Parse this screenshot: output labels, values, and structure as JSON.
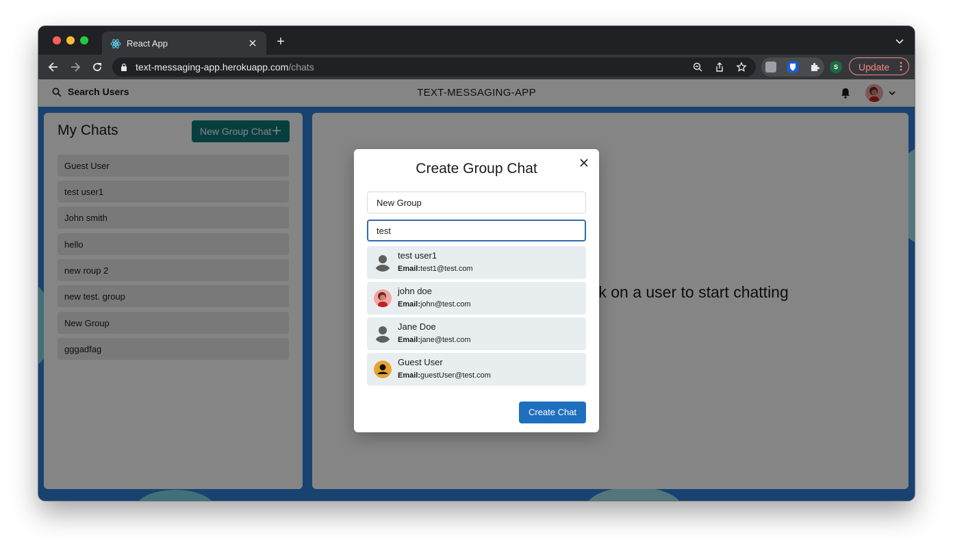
{
  "browser": {
    "tab_title": "React App",
    "new_tab_symbol": "+",
    "url_host": "text-messaging-app.herokuapp.com",
    "url_path": "/chats",
    "profile_initial": "S",
    "update_label": "Update"
  },
  "header": {
    "search_label": "Search Users",
    "app_title": "TEXT-MESSAGING-APP"
  },
  "chats": {
    "title": "My Chats",
    "new_group_label": "New Group Chat",
    "items": [
      {
        "label": "Guest User"
      },
      {
        "label": "test user1"
      },
      {
        "label": "John smith"
      },
      {
        "label": "hello"
      },
      {
        "label": "new roup 2"
      },
      {
        "label": "new test. group"
      },
      {
        "label": "New Group"
      },
      {
        "label": "gggadfag"
      }
    ]
  },
  "main": {
    "placeholder": "Click on a user to start chatting"
  },
  "modal": {
    "title": "Create Group Chat",
    "group_name_value": "New Group",
    "search_value": "test",
    "email_label": "Email:",
    "results": [
      {
        "name": "test user1",
        "email": "test1@test.com",
        "avatar": "default-user-icon"
      },
      {
        "name": "john doe",
        "email": "john@test.com",
        "avatar": "photo-avatar"
      },
      {
        "name": "Jane Doe",
        "email": "jane@test.com",
        "avatar": "default-user-icon"
      },
      {
        "name": "Guest User",
        "email": "guestUser@test.com",
        "avatar": "guest-user-icon"
      }
    ],
    "create_label": "Create Chat"
  },
  "colors": {
    "accent_teal": "#0f7a7a",
    "primary_blue": "#1f6fbf",
    "update_red": "#f28b82"
  }
}
